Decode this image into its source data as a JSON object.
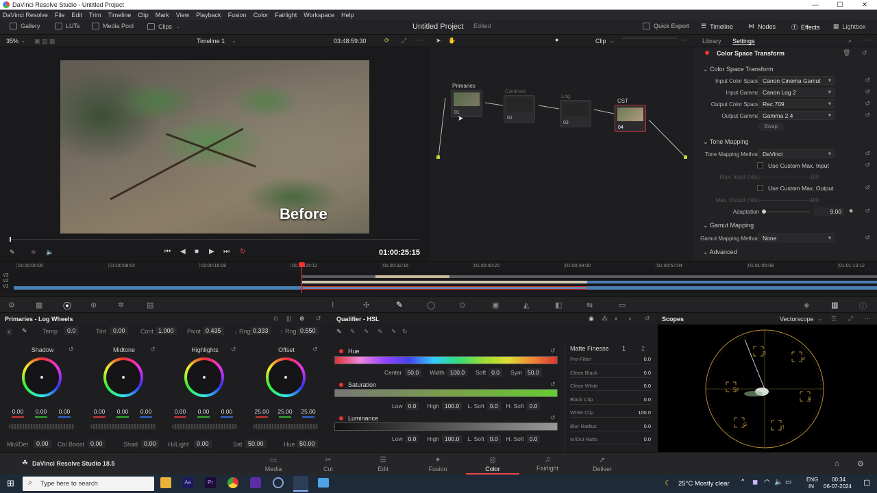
{
  "titlebar": {
    "title": "DaVinci Resolve Studio - Untitled Project"
  },
  "menu": [
    "DaVinci Resolve",
    "File",
    "Edit",
    "Trim",
    "Timeline",
    "Clip",
    "Mark",
    "View",
    "Playback",
    "Fusion",
    "Color",
    "Fairlight",
    "Workspace",
    "Help"
  ],
  "toolbar": {
    "gallery": "Gallery",
    "luts": "LUTs",
    "media_pool": "Media Pool",
    "clips": "Clips",
    "project": "Untitled Project",
    "edited": "Edited",
    "quick_export": "Quick Export",
    "timeline": "Timeline",
    "nodes": "Nodes",
    "effects": "Effects",
    "lightbox": "Lightbox"
  },
  "viewer": {
    "zoom": "35%",
    "timeline_name": "Timeline 1",
    "source_tc": "03:48:59:30",
    "overlay_text": "Before",
    "timecode": "01:00:25:15"
  },
  "nodehdr": {
    "mode": "Clip"
  },
  "nodes": [
    {
      "label": "Primaries",
      "num": "01"
    },
    {
      "label": "Contrast",
      "num": "02"
    },
    {
      "label": "Log",
      "num": "03"
    },
    {
      "label": "CST",
      "num": "04"
    }
  ],
  "settings": {
    "tabs": [
      "Library",
      "Settings"
    ],
    "effect_title": "Color Space Transform",
    "cst_section": "Color Space Transform",
    "input_color_space_label": "Input Color Space",
    "input_color_space": "Canon Cinema Gamut",
    "input_gamma_label": "Input Gamma",
    "input_gamma": "Canon Log 2",
    "output_color_space_label": "Output Color Space",
    "output_color_space": "Rec.709",
    "output_gamma_label": "Output Gamma",
    "output_gamma": "Gamma 2.4",
    "swap": "Swap",
    "tone_section": "Tone Mapping",
    "tone_method_label": "Tone Mapping Method",
    "tone_method": "DaVinci",
    "custom_max_input": "Use Custom Max. Input",
    "max_input_label": "Max. Input (nits)",
    "max_input": "100",
    "custom_max_output": "Use Custom Max. Output",
    "max_output_label": "Max. Output (nits)",
    "max_output": "100",
    "adaptation_label": "Adaptation",
    "adaptation": "9.00",
    "gamut_section": "Gamut Mapping",
    "gamut_method_label": "Gamut Mapping Method",
    "gamut_method": "None",
    "advanced": "Advanced"
  },
  "ruler": [
    "01:00:00:00",
    "01:00:08:04",
    "01:00:16:08",
    "01:00:24:12",
    "01:00:32:16",
    "01:00:40:20",
    "01:00:49:00",
    "01:00:57:04",
    "01:01:05:08",
    "01:01:13:12"
  ],
  "tracks": [
    "V3",
    "V2",
    "V1"
  ],
  "primaries": {
    "title": "Primaries - Log Wheels",
    "temp_label": "Temp",
    "temp": "0.0",
    "tint_label": "Tint",
    "tint": "0.00",
    "cont_label": "Cont",
    "cont": "1.000",
    "pivot_label": "Pivot",
    "pivot": "0.435",
    "lrng_label": "↓ Rng",
    "lrng": "0.333",
    "hrng_label": "↑ Rng",
    "hrng": "0.550",
    "wheels": [
      {
        "name": "Shadow",
        "vals": [
          "0.00",
          "0.00",
          "0.00"
        ]
      },
      {
        "name": "Midtone",
        "vals": [
          "0.00",
          "0.00",
          "0.00"
        ]
      },
      {
        "name": "Highlights",
        "vals": [
          "0.00",
          "0.00",
          "0.00"
        ]
      },
      {
        "name": "Offset",
        "vals": [
          "25.00",
          "25.00",
          "25.00"
        ]
      }
    ],
    "middet_label": "Mid/Det",
    "middet": "0.00",
    "colboost_label": "Col Boost",
    "colboost": "0.00",
    "shad_label": "Shad",
    "shad": "0.00",
    "hilight_label": "Hi/Light",
    "hilight": "0.00",
    "sat_label": "Sat",
    "sat": "50.00",
    "hue_label": "Hue",
    "hue": "50.00"
  },
  "qualifier": {
    "title": "Qualifier - HSL",
    "hue": "Hue",
    "center_label": "Center",
    "center": "50.0",
    "width_label": "Width",
    "width": "100.0",
    "soft_label": "Soft",
    "soft": "0.0",
    "sym_label": "Sym",
    "sym": "50.0",
    "saturation": "Saturation",
    "low_label": "Low",
    "sat_low": "0.0",
    "high_label": "High",
    "sat_high": "100.0",
    "lsoft_label": "L. Soft",
    "sat_lsoft": "0.0",
    "hsoft_label": "H. Soft",
    "sat_hsoft": "0.0",
    "luminance": "Luminance",
    "lum_low": "0.0",
    "lum_high": "100.0",
    "lum_lsoft": "0.0",
    "lum_hsoft": "0.0",
    "matte_finesse": "Matte Finesse",
    "mf_tab1": "1",
    "mf_tab2": "2",
    "mf_rows": [
      {
        "label": "Pre-Filter",
        "val": "0.0"
      },
      {
        "label": "Clean Black",
        "val": "0.0"
      },
      {
        "label": "Clean White",
        "val": "0.0"
      },
      {
        "label": "Black Clip",
        "val": "0.0"
      },
      {
        "label": "White Clip",
        "val": "100.0"
      },
      {
        "label": "Blur Radius",
        "val": "0.0"
      },
      {
        "label": "In/Out Ratio",
        "val": "0.0"
      }
    ]
  },
  "scopes": {
    "title": "Scopes",
    "type": "Vectorscope",
    "targets": [
      "R",
      "M",
      "B",
      "Cy",
      "G",
      "Yl"
    ]
  },
  "pages": [
    {
      "label": "Media",
      "icon": "▭"
    },
    {
      "label": "Cut",
      "icon": "✂"
    },
    {
      "label": "Edit",
      "icon": "☰"
    },
    {
      "label": "Fusion",
      "icon": "✦"
    },
    {
      "label": "Color",
      "icon": "◎"
    },
    {
      "label": "Fairlight",
      "icon": "♫"
    },
    {
      "label": "Deliver",
      "icon": "➚"
    }
  ],
  "active_page": "Color",
  "product": "DaVinci Resolve Studio 18.5",
  "taskbar": {
    "search_placeholder": "Type here to search",
    "weather": "25°C  Mostly clear",
    "lang": "ENG",
    "region": "IN",
    "time": "00:34",
    "date": "06-07-2024"
  }
}
